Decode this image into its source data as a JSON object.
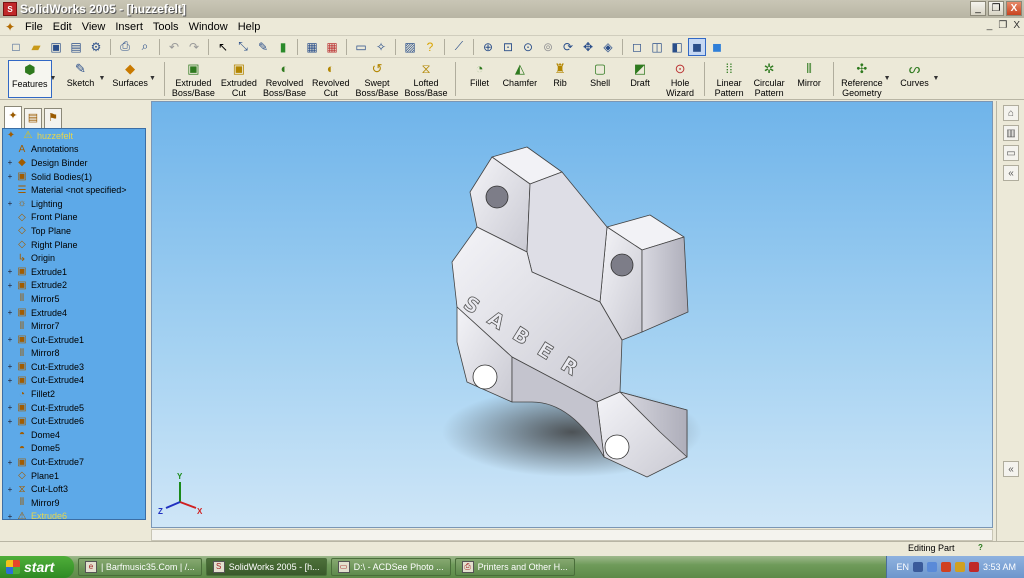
{
  "window": {
    "title": "SolidWorks 2005 - [huzzefelt]",
    "min_label": "_",
    "restore_label": "❐",
    "close_label": "X"
  },
  "menu": {
    "items": [
      "File",
      "Edit",
      "View",
      "Insert",
      "Tools",
      "Window",
      "Help"
    ],
    "doc_controls": [
      "_",
      "❐",
      "X"
    ]
  },
  "command_manager": {
    "features_label": "Features",
    "sketch_label": "Sketch",
    "surfaces_label": "Surfaces",
    "items": [
      {
        "line1": "Extruded",
        "line2": "Boss/Base"
      },
      {
        "line1": "Extruded",
        "line2": "Cut"
      },
      {
        "line1": "Revolved",
        "line2": "Boss/Base"
      },
      {
        "line1": "Revolved",
        "line2": "Cut"
      },
      {
        "line1": "Swept",
        "line2": "Boss/Base"
      },
      {
        "line1": "Lofted",
        "line2": "Boss/Base"
      },
      {
        "line1": "Fillet",
        "line2": ""
      },
      {
        "line1": "Chamfer",
        "line2": ""
      },
      {
        "line1": "Rib",
        "line2": ""
      },
      {
        "line1": "Shell",
        "line2": ""
      },
      {
        "line1": "Draft",
        "line2": ""
      },
      {
        "line1": "Hole",
        "line2": "Wizard"
      },
      {
        "line1": "Linear",
        "line2": "Pattern"
      },
      {
        "line1": "Circular",
        "line2": "Pattern"
      },
      {
        "line1": "Mirror",
        "line2": ""
      },
      {
        "line1": "Reference",
        "line2": "Geometry"
      },
      {
        "line1": "Curves",
        "line2": ""
      }
    ]
  },
  "feature_tree": {
    "root": "huzzefelt",
    "items": [
      {
        "label": "Annotations",
        "expandable": false,
        "icon": "annotations-icon"
      },
      {
        "label": "Design Binder",
        "expandable": true,
        "icon": "binder-icon"
      },
      {
        "label": "Solid Bodies(1)",
        "expandable": true,
        "icon": "solid-bodies-icon"
      },
      {
        "label": "Material <not specified>",
        "expandable": false,
        "icon": "material-icon"
      },
      {
        "label": "Lighting",
        "expandable": true,
        "icon": "lighting-icon"
      },
      {
        "label": "Front Plane",
        "expandable": false,
        "icon": "plane-icon"
      },
      {
        "label": "Top Plane",
        "expandable": false,
        "icon": "plane-icon"
      },
      {
        "label": "Right Plane",
        "expandable": false,
        "icon": "plane-icon"
      },
      {
        "label": "Origin",
        "expandable": false,
        "icon": "origin-icon"
      },
      {
        "label": "Extrude1",
        "expandable": true,
        "icon": "extrude-icon"
      },
      {
        "label": "Extrude2",
        "expandable": true,
        "icon": "extrude-icon"
      },
      {
        "label": "Mirror5",
        "expandable": false,
        "icon": "mirror-icon"
      },
      {
        "label": "Extrude4",
        "expandable": true,
        "icon": "extrude-icon"
      },
      {
        "label": "Mirror7",
        "expandable": false,
        "icon": "mirror-icon"
      },
      {
        "label": "Cut-Extrude1",
        "expandable": true,
        "icon": "cut-extrude-icon"
      },
      {
        "label": "Mirror8",
        "expandable": false,
        "icon": "mirror-icon"
      },
      {
        "label": "Cut-Extrude3",
        "expandable": true,
        "icon": "cut-extrude-icon"
      },
      {
        "label": "Cut-Extrude4",
        "expandable": true,
        "icon": "cut-extrude-icon"
      },
      {
        "label": "Fillet2",
        "expandable": false,
        "icon": "fillet-icon"
      },
      {
        "label": "Cut-Extrude5",
        "expandable": true,
        "icon": "cut-extrude-icon"
      },
      {
        "label": "Cut-Extrude6",
        "expandable": true,
        "icon": "cut-extrude-icon"
      },
      {
        "label": "Dome4",
        "expandable": false,
        "icon": "dome-icon"
      },
      {
        "label": "Dome5",
        "expandable": false,
        "icon": "dome-icon"
      },
      {
        "label": "Cut-Extrude7",
        "expandable": true,
        "icon": "cut-extrude-icon"
      },
      {
        "label": "Plane1",
        "expandable": false,
        "icon": "plane-icon"
      },
      {
        "label": "Cut-Loft3",
        "expandable": true,
        "icon": "cut-loft-icon"
      },
      {
        "label": "Mirror9",
        "expandable": false,
        "icon": "mirror-icon"
      },
      {
        "label": "Extrude6",
        "expandable": true,
        "icon": "extrude-warning-icon"
      }
    ]
  },
  "viewport": {
    "part_engraving": "SABER",
    "triad": {
      "x": "X",
      "y": "Y",
      "z": "Z"
    }
  },
  "status": {
    "text": "Editing Part",
    "help": "?"
  },
  "taskbar": {
    "start_label": "start",
    "tasks": [
      {
        "label": "| Barfmusic35.Com | /...",
        "active": false
      },
      {
        "label": "SolidWorks 2005 - [h...",
        "active": true
      },
      {
        "label": "D:\\ - ACDSee Photo ...",
        "active": false
      },
      {
        "label": "Printers and Other H...",
        "active": false
      }
    ],
    "tray_lang": "EN",
    "clock": "3:53 AM"
  },
  "colors": {
    "tree_background": "#5da9e8",
    "viewport_top": "#6fb4ea",
    "viewport_bottom": "#cfe6f7",
    "part_body": "#e6e6ec",
    "taskbar": "#5d8a48"
  }
}
